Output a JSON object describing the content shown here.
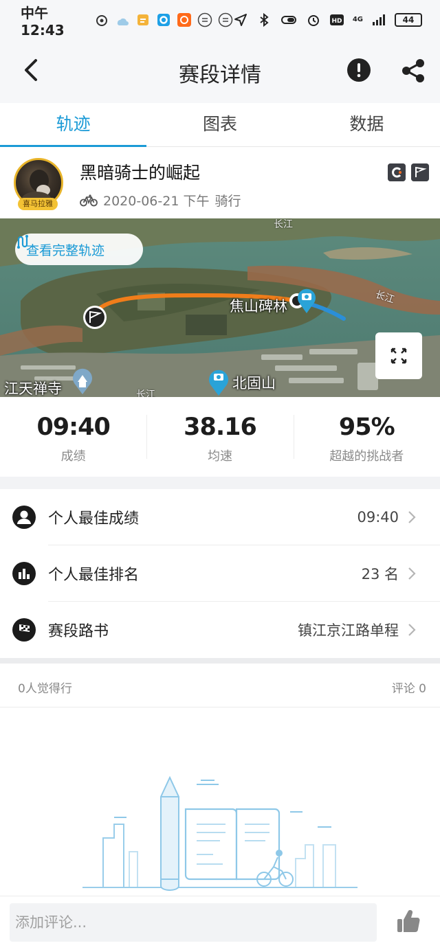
{
  "status_bar": {
    "time": "中午12:43",
    "battery": "44",
    "network": "4G"
  },
  "header": {
    "title": "赛段详情",
    "back_icon": "chevron-left-icon",
    "report_icon": "alert-circle-icon",
    "share_icon": "share-icon"
  },
  "tabs": [
    {
      "label": "轨迹",
      "active": true
    },
    {
      "label": "图表",
      "active": false
    },
    {
      "label": "数据",
      "active": false
    }
  ],
  "segment": {
    "title": "黑暗骑士的崛起",
    "date": "2020-06-21 下午",
    "activity": "骑行",
    "avatar_badge": "喜马拉雅"
  },
  "map": {
    "track_button_label": "查看完整轨迹",
    "labels": {
      "jiaoshan": "焦山碑林",
      "beigushan": "北固山",
      "jiangtian": "江天禅寺",
      "changjiang_top": "长江",
      "changjiang_right": "长江",
      "changjiang_bottom": "长江"
    },
    "track_colors": {
      "main": "#f07d1a",
      "tail": "#2b8fd8"
    }
  },
  "stats": [
    {
      "value": "09:40",
      "label": "成绩"
    },
    {
      "value": "38.16",
      "label": "均速"
    },
    {
      "value": "95%",
      "label": "超越的挑战者"
    }
  ],
  "list": [
    {
      "label": "个人最佳成绩",
      "value": "09:40",
      "icon": "person-icon"
    },
    {
      "label": "个人最佳排名",
      "value": "23 名",
      "icon": "ranking-icon"
    },
    {
      "label": "赛段路书",
      "value": "镇江京江路单程",
      "icon": "checkered-flag-icon"
    }
  ],
  "social": {
    "likes": "0人觉得行",
    "comments": "评论 0"
  },
  "comment": {
    "placeholder": "添加评论..."
  },
  "colors": {
    "accent": "#1a9ad6"
  }
}
